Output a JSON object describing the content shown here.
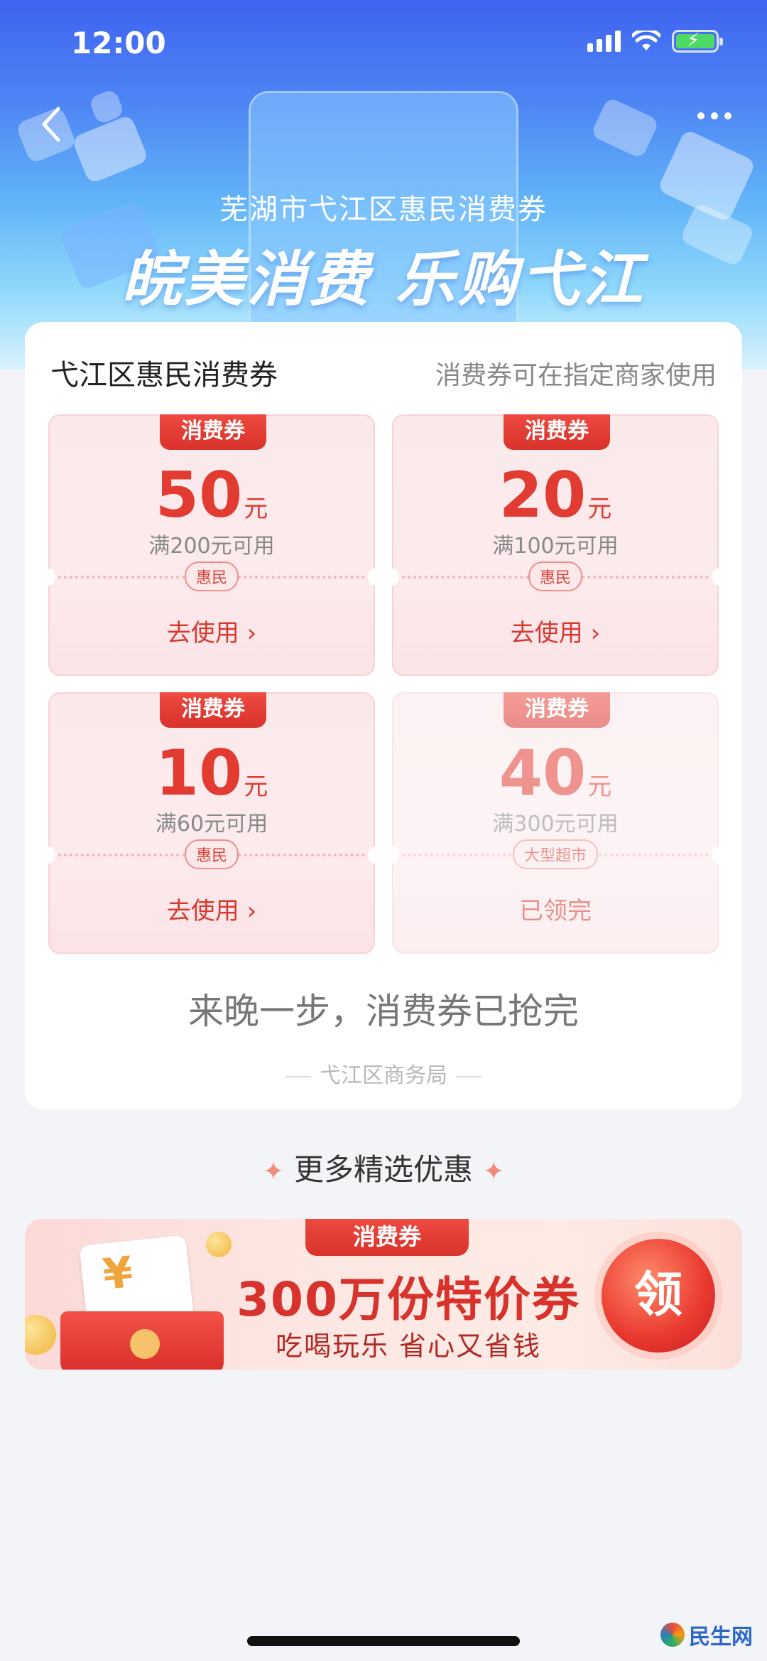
{
  "status_bar": {
    "time": "12:00"
  },
  "header": {
    "subtitle": "芜湖市弋江区惠民消费券",
    "title": "皖美消费 乐购弋江"
  },
  "coupon_card": {
    "title": "弋江区惠民消费券",
    "note": "消费券可在指定商家使用",
    "coupons": [
      {
        "tag": "消费券",
        "amount": "50",
        "unit": "元",
        "condition": "满200元可用",
        "badge": "惠民",
        "action": "去使用 ›"
      },
      {
        "tag": "消费券",
        "amount": "20",
        "unit": "元",
        "condition": "满100元可用",
        "badge": "惠民",
        "action": "去使用 ›"
      },
      {
        "tag": "消费券",
        "amount": "10",
        "unit": "元",
        "condition": "满60元可用",
        "badge": "惠民",
        "action": "去使用 ›"
      },
      {
        "tag": "消费券",
        "amount": "40",
        "unit": "元",
        "condition": "满300元可用",
        "badge": "大型超市",
        "action": "已领完"
      }
    ],
    "sold_out_message": "来晚一步，消费券已抢完",
    "issuer": "弋江区商务局"
  },
  "more_deals": {
    "title": "更多精选优惠"
  },
  "banner": {
    "tag": "消费券",
    "headline": "300万份特价券",
    "subline": "吃喝玩乐 省心又省钱",
    "claim": "领",
    "envelope_symbol": "¥"
  },
  "watermark": {
    "text": "民生网"
  },
  "colors": {
    "accent_red": "#e23c32",
    "hero_blue": "#4d86f4"
  }
}
